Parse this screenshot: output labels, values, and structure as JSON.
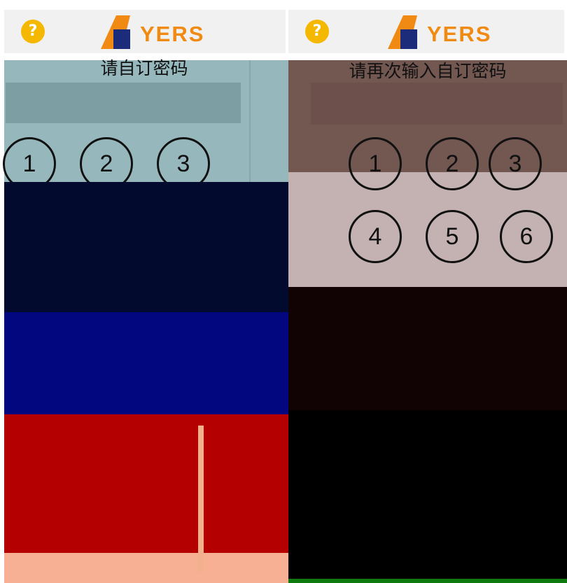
{
  "screens": [
    {
      "title": "请自订密码",
      "header": {
        "help_icon": "question-circle-icon",
        "logo_text": "YERS"
      },
      "keypad": [
        "1",
        "2",
        "3"
      ]
    },
    {
      "title": "请再次输入自订密码",
      "header": {
        "help_icon": "question-circle-icon",
        "logo_text": "YERS"
      },
      "keypad": [
        "1",
        "2",
        "3",
        "4",
        "5",
        "6"
      ]
    }
  ],
  "colors": {
    "accent": "#f08a12",
    "help": "#f5b800",
    "logo_blue": "#1c2c7a"
  }
}
